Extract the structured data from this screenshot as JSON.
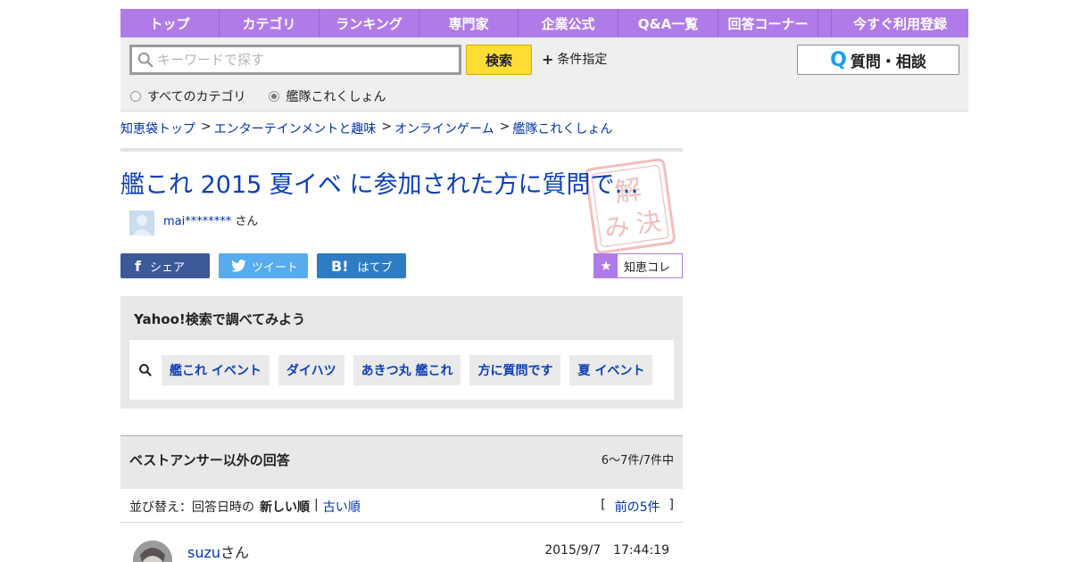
{
  "nav": {
    "items": [
      {
        "label": "トップ",
        "w": 111
      },
      {
        "label": "カテゴリ",
        "w": 112
      },
      {
        "label": "ランキング",
        "w": 112
      },
      {
        "label": "専門家",
        "w": 111
      },
      {
        "label": "企業公式",
        "w": 112
      },
      {
        "label": "Q&A一覧",
        "w": 112
      },
      {
        "label": "回答コーナー",
        "w": 112
      },
      {
        "label": "",
        "w": 15
      },
      {
        "label": "今すぐ利用登録",
        "w": 153
      }
    ]
  },
  "search": {
    "placeholder": "キーワードで探す",
    "button": "検索",
    "condition": "条件指定",
    "scope_all": "すべてのカテゴリ",
    "scope_current": "艦隊これくしょん",
    "ask_button": "質問・相談"
  },
  "breadcrumb": [
    "知恵袋トップ",
    "エンターテインメントと趣味",
    "オンラインゲーム",
    "艦隊これくしょん"
  ],
  "crumb_sep": ">",
  "question": {
    "title": "艦これ 2015 夏イベ に参加された方に質問で…",
    "stamp": [
      "解決済み"
    ],
    "user": "mai********",
    "user_suffix": "さん"
  },
  "share": {
    "facebook": "シェア",
    "twitter": "ツイート",
    "hatena": "はてブ",
    "chie_kore": "知恵コレ"
  },
  "yahoo_search": {
    "title": "Yahoo!検索で調べてみよう",
    "keywords": [
      "艦これ イベント",
      "ダイハツ",
      "あきつ丸 艦これ",
      "方に質問です",
      "夏 イベント"
    ]
  },
  "answers": {
    "heading": "ベストアンサー以外の回答",
    "count": "6〜7件/7件中",
    "sort_label": "並び替え：回答日時の",
    "sort_new": "新しい順",
    "sort_sep": "|",
    "sort_old": "古い順",
    "prev_open": "[",
    "prev_link": "前の5件",
    "prev_close": "]",
    "first_answer": {
      "user": "suzu",
      "suffix": "さん",
      "date": "2015/9/7　17:44:19"
    }
  },
  "colors": {
    "nav": "#b07be8",
    "search_button": "#ffdd35",
    "link": "#0033aa",
    "title": "#0d3fb5",
    "facebook": "#3b5998",
    "twitter": "#55acee",
    "hatena": "#2e7cc4",
    "stamp": "#e98a8a"
  }
}
